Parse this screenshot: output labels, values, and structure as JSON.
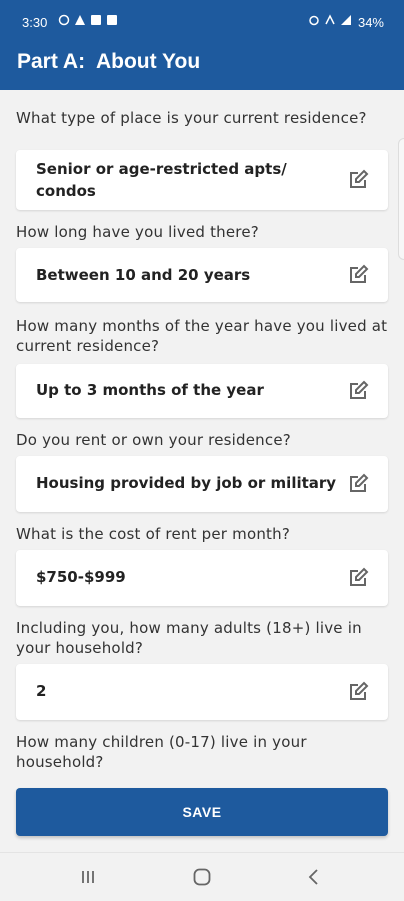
{
  "status_bar": {
    "time": "3:30",
    "battery": "34%",
    "left_icons": [
      "whatsapp-icon",
      "alert-icon",
      "image-icon",
      "image-icon"
    ],
    "right_icons": [
      "alarm-icon",
      "nfc-icon",
      "signal-icon"
    ]
  },
  "header": {
    "title": "Part A:  About You"
  },
  "questions": [
    {
      "question": "What type of place is your current residence?",
      "answer": "Senior or age-restricted apts/ condos"
    },
    {
      "question": "How long have you lived there?",
      "answer": "Between 10 and 20 years"
    },
    {
      "question": "How many months of the year have you lived at current residence?",
      "answer": "Up to 3 months of the year"
    },
    {
      "question": "Do you rent or own your residence?",
      "answer": "Housing provided by job or military"
    },
    {
      "question": "What is the cost of rent per month?",
      "answer": "$750-$999"
    },
    {
      "question": "Including you, how many adults (18+) live in your household?",
      "answer": "2"
    },
    {
      "question": "How many children (0-17) live in your household?",
      "answer": ""
    }
  ],
  "save_label": "SAVE",
  "colors": {
    "primary": "#1e5a9e",
    "background": "#f2f2f2",
    "card": "#ffffff"
  },
  "nav": [
    "recents-icon",
    "home-icon",
    "back-icon"
  ]
}
